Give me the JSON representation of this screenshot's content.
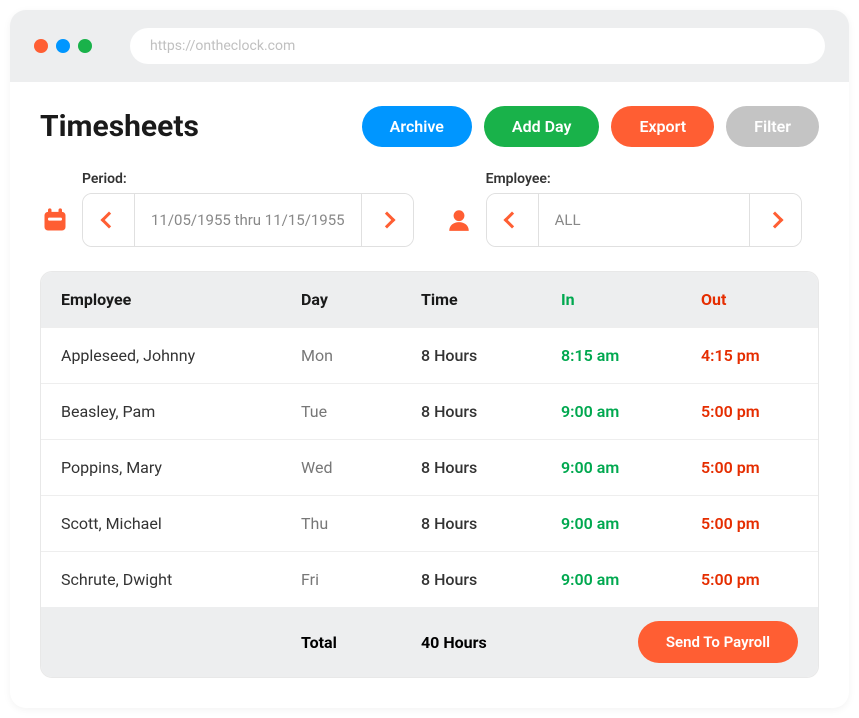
{
  "browser": {
    "url": "https://ontheclock.com"
  },
  "page": {
    "title": "Timesheets"
  },
  "actions": {
    "archive": "Archive",
    "addDay": "Add Day",
    "export": "Export",
    "filter": "Filter"
  },
  "filters": {
    "period": {
      "label": "Period:",
      "value": "11/05/1955 thru 11/15/1955"
    },
    "employee": {
      "label": "Employee:",
      "value": "ALL"
    }
  },
  "table": {
    "headers": {
      "employee": "Employee",
      "day": "Day",
      "time": "Time",
      "in": "In",
      "out": "Out"
    },
    "rows": [
      {
        "employee": "Appleseed, Johnny",
        "day": "Mon",
        "time": "8 Hours",
        "in": "8:15 am",
        "out": "4:15 pm"
      },
      {
        "employee": "Beasley, Pam",
        "day": "Tue",
        "time": "8 Hours",
        "in": "9:00 am",
        "out": "5:00 pm"
      },
      {
        "employee": "Poppins, Mary",
        "day": "Wed",
        "time": "8 Hours",
        "in": "9:00 am",
        "out": "5:00 pm"
      },
      {
        "employee": "Scott, Michael",
        "day": "Thu",
        "time": "8 Hours",
        "in": "9:00 am",
        "out": "5:00 pm"
      },
      {
        "employee": "Schrute, Dwight",
        "day": "Fri",
        "time": "8 Hours",
        "in": "9:00 am",
        "out": "5:00 pm"
      }
    ],
    "footer": {
      "totalLabel": "Total",
      "totalValue": "40 Hours",
      "payrollButton": "Send To Payroll"
    }
  },
  "colors": {
    "accent": "#ff5e33",
    "blue": "#0096ff",
    "green": "#19b24a",
    "grey": "#c4c4c4",
    "inGreen": "#00a84f",
    "outRed": "#e52d00"
  }
}
